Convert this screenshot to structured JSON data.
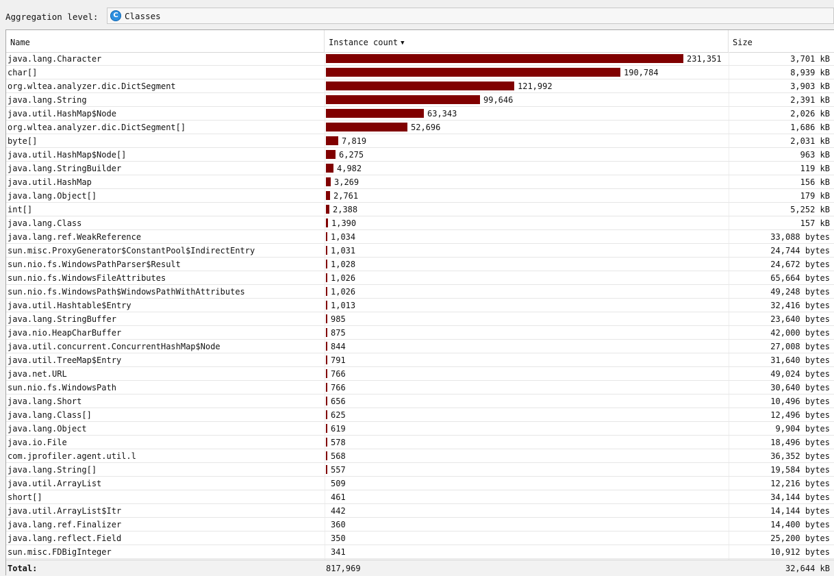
{
  "toolbar": {
    "aggregation_label": "Aggregation level:",
    "aggregation_value": "Classes",
    "class_icon_letter": "C"
  },
  "table": {
    "columns": {
      "name": "Name",
      "instance_count": "Instance count",
      "size": "Size"
    },
    "sort": {
      "column": "instance_count",
      "direction": "descending",
      "icon": "sort-descending-icon"
    },
    "bar_color": "#800000",
    "max_count": 231351,
    "rows": [
      {
        "name": "java.lang.Character",
        "count": 231351,
        "count_label": "231,351",
        "size": "3,701 kB"
      },
      {
        "name": "char[]",
        "count": 190784,
        "count_label": "190,784",
        "size": "8,939 kB"
      },
      {
        "name": "org.wltea.analyzer.dic.DictSegment",
        "count": 121992,
        "count_label": "121,992",
        "size": "3,903 kB"
      },
      {
        "name": "java.lang.String",
        "count": 99646,
        "count_label": "99,646",
        "size": "2,391 kB"
      },
      {
        "name": "java.util.HashMap$Node",
        "count": 63343,
        "count_label": "63,343",
        "size": "2,026 kB"
      },
      {
        "name": "org.wltea.analyzer.dic.DictSegment[]",
        "count": 52696,
        "count_label": "52,696",
        "size": "1,686 kB"
      },
      {
        "name": "byte[]",
        "count": 7819,
        "count_label": "7,819",
        "size": "2,031 kB"
      },
      {
        "name": "java.util.HashMap$Node[]",
        "count": 6275,
        "count_label": "6,275",
        "size": "963 kB"
      },
      {
        "name": "java.lang.StringBuilder",
        "count": 4982,
        "count_label": "4,982",
        "size": "119 kB"
      },
      {
        "name": "java.util.HashMap",
        "count": 3269,
        "count_label": "3,269",
        "size": "156 kB"
      },
      {
        "name": "java.lang.Object[]",
        "count": 2761,
        "count_label": "2,761",
        "size": "179 kB"
      },
      {
        "name": "int[]",
        "count": 2388,
        "count_label": "2,388",
        "size": "5,252 kB"
      },
      {
        "name": "java.lang.Class",
        "count": 1390,
        "count_label": "1,390",
        "size": "157 kB"
      },
      {
        "name": "java.lang.ref.WeakReference",
        "count": 1034,
        "count_label": "1,034",
        "size": "33,088 bytes"
      },
      {
        "name": "sun.misc.ProxyGenerator$ConstantPool$IndirectEntry",
        "count": 1031,
        "count_label": "1,031",
        "size": "24,744 bytes"
      },
      {
        "name": "sun.nio.fs.WindowsPathParser$Result",
        "count": 1028,
        "count_label": "1,028",
        "size": "24,672 bytes"
      },
      {
        "name": "sun.nio.fs.WindowsFileAttributes",
        "count": 1026,
        "count_label": "1,026",
        "size": "65,664 bytes"
      },
      {
        "name": "sun.nio.fs.WindowsPath$WindowsPathWithAttributes",
        "count": 1026,
        "count_label": "1,026",
        "size": "49,248 bytes"
      },
      {
        "name": "java.util.Hashtable$Entry",
        "count": 1013,
        "count_label": "1,013",
        "size": "32,416 bytes"
      },
      {
        "name": "java.lang.StringBuffer",
        "count": 985,
        "count_label": "985",
        "size": "23,640 bytes"
      },
      {
        "name": "java.nio.HeapCharBuffer",
        "count": 875,
        "count_label": "875",
        "size": "42,000 bytes"
      },
      {
        "name": "java.util.concurrent.ConcurrentHashMap$Node",
        "count": 844,
        "count_label": "844",
        "size": "27,008 bytes"
      },
      {
        "name": "java.util.TreeMap$Entry",
        "count": 791,
        "count_label": "791",
        "size": "31,640 bytes"
      },
      {
        "name": "java.net.URL",
        "count": 766,
        "count_label": "766",
        "size": "49,024 bytes"
      },
      {
        "name": "sun.nio.fs.WindowsPath",
        "count": 766,
        "count_label": "766",
        "size": "30,640 bytes"
      },
      {
        "name": "java.lang.Short",
        "count": 656,
        "count_label": "656",
        "size": "10,496 bytes"
      },
      {
        "name": "java.lang.Class[]",
        "count": 625,
        "count_label": "625",
        "size": "12,496 bytes"
      },
      {
        "name": "java.lang.Object",
        "count": 619,
        "count_label": "619",
        "size": "9,904 bytes"
      },
      {
        "name": "java.io.File",
        "count": 578,
        "count_label": "578",
        "size": "18,496 bytes"
      },
      {
        "name": "com.jprofiler.agent.util.l",
        "count": 568,
        "count_label": "568",
        "size": "36,352 bytes"
      },
      {
        "name": "java.lang.String[]",
        "count": 557,
        "count_label": "557",
        "size": "19,584 bytes"
      },
      {
        "name": "java.util.ArrayList",
        "count": 509,
        "count_label": "509",
        "size": "12,216 bytes"
      },
      {
        "name": "short[]",
        "count": 461,
        "count_label": "461",
        "size": "34,144 bytes"
      },
      {
        "name": "java.util.ArrayList$Itr",
        "count": 442,
        "count_label": "442",
        "size": "14,144 bytes"
      },
      {
        "name": "java.lang.ref.Finalizer",
        "count": 360,
        "count_label": "360",
        "size": "14,400 bytes"
      },
      {
        "name": "java.lang.reflect.Field",
        "count": 350,
        "count_label": "350",
        "size": "25,200 bytes"
      },
      {
        "name": "sun.misc.FDBigInteger",
        "count": 341,
        "count_label": "341",
        "size": "10,912 bytes"
      }
    ],
    "total": {
      "label": "Total:",
      "count": "817,969",
      "size": "32,644 kB"
    }
  }
}
